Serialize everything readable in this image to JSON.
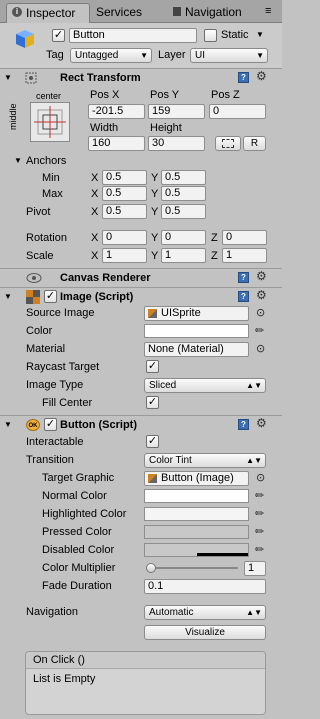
{
  "tabs": [
    {
      "label": "Inspector",
      "icon": "info-icon",
      "active": true
    },
    {
      "label": "Services",
      "active": false
    },
    {
      "label": "Navigation",
      "icon": "navigation-icon",
      "active": false
    }
  ],
  "object": {
    "active": true,
    "name": "Button",
    "static_label": "Static",
    "static": false,
    "tag_label": "Tag",
    "tag_value": "Untagged",
    "layer_label": "Layer",
    "layer_value": "UI"
  },
  "rect_transform": {
    "title": "Rect Transform",
    "anchor_h": "center",
    "anchor_v": "middle",
    "pos_x_label": "Pos X",
    "pos_y_label": "Pos Y",
    "pos_z_label": "Pos Z",
    "pos_x": "-201.5",
    "pos_y": "159",
    "pos_z": "0",
    "width_label": "Width",
    "height_label": "Height",
    "width": "160",
    "height": "30",
    "r_button": "R",
    "anchors_label": "Anchors",
    "min_label": "Min",
    "max_label": "Max",
    "min_x": "0.5",
    "min_y": "0.5",
    "max_x": "0.5",
    "max_y": "0.5",
    "pivot_label": "Pivot",
    "pivot_x": "0.5",
    "pivot_y": "0.5",
    "rotation_label": "Rotation",
    "rot_x": "0",
    "rot_y": "0",
    "rot_z": "0",
    "scale_label": "Scale",
    "scale_x": "1",
    "scale_y": "1",
    "scale_z": "1",
    "x": "X",
    "y": "Y",
    "z": "Z"
  },
  "canvas_renderer": {
    "title": "Canvas Renderer"
  },
  "image": {
    "title": "Image (Script)",
    "enabled": true,
    "source_image_label": "Source Image",
    "source_image": "UISprite",
    "color_label": "Color",
    "color": "#ffffff",
    "material_label": "Material",
    "material": "None (Material)",
    "raycast_label": "Raycast Target",
    "raycast": true,
    "image_type_label": "Image Type",
    "image_type": "Sliced",
    "fill_center_label": "Fill Center",
    "fill_center": true
  },
  "button": {
    "title": "Button (Script)",
    "badge": "OK",
    "enabled": true,
    "interactable_label": "Interactable",
    "interactable": true,
    "transition_label": "Transition",
    "transition": "Color Tint",
    "target_graphic_label": "Target Graphic",
    "target_graphic": "Button (Image)",
    "normal_label": "Normal Color",
    "normal": "#ffffff",
    "highlighted_label": "Highlighted Color",
    "highlighted": "#f5f5f5",
    "pressed_label": "Pressed Color",
    "pressed": "#c8c8c8",
    "disabled_label": "Disabled Color",
    "disabled": "#c8c8c8",
    "multiplier_label": "Color Multiplier",
    "multiplier": "1",
    "multiplier_fraction": 0.0,
    "fade_label": "Fade Duration",
    "fade": "0.1",
    "navigation_label": "Navigation",
    "navigation": "Automatic",
    "visualize_label": "Visualize"
  },
  "on_click": {
    "title": "On Click ()",
    "empty_text": "List is Empty"
  }
}
